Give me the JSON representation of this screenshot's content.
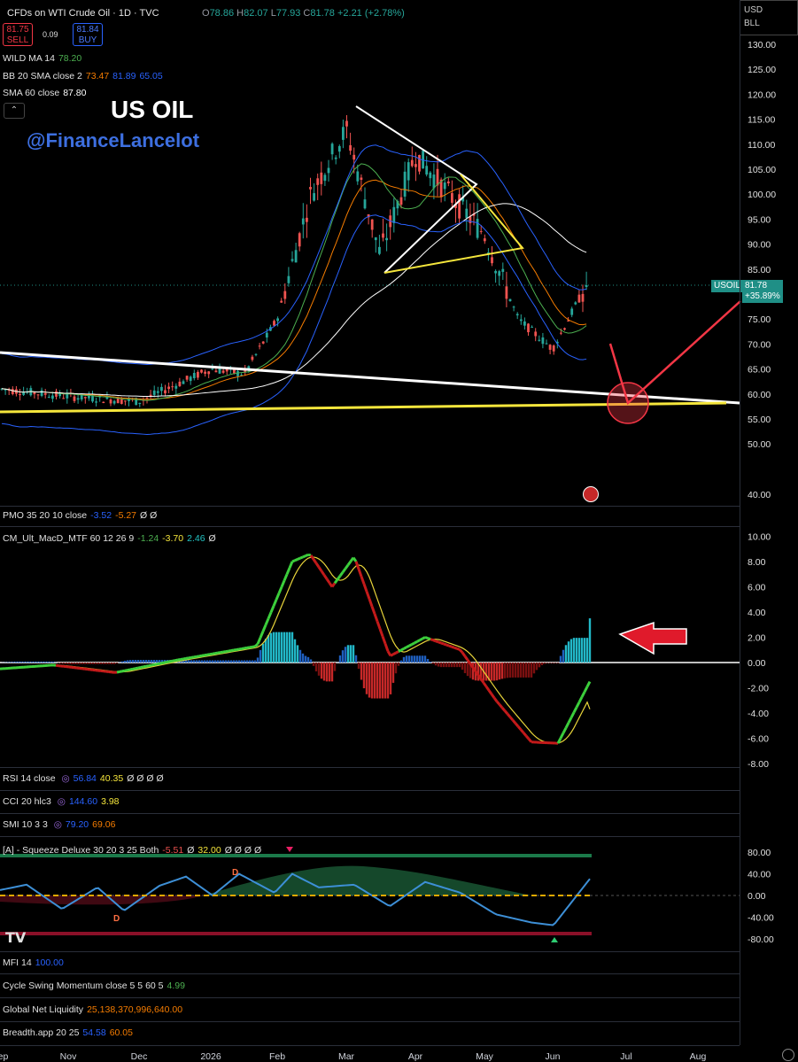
{
  "header": {
    "symbol": "CFDs on WTI Crude Oil · 1D · TVC",
    "o_label": "O",
    "o_value": "78.86",
    "h_label": "H",
    "h_value": "82.07",
    "l_label": "L",
    "l_value": "77.93",
    "c_label": "C",
    "c_value": "81.78",
    "change": "+2.21 (+2.78%)"
  },
  "trade": {
    "sell_price": "81.75",
    "sell_label": "SELL",
    "spread": "0.09",
    "buy_price": "81.84",
    "buy_label": "BUY"
  },
  "currency": {
    "line1": "USD",
    "line2": "BLL"
  },
  "overlay": {
    "title": "US OIL",
    "handle": "@FinanceLancelot"
  },
  "legends": {
    "wild": {
      "name": "WILD MA 14",
      "v1": "78.20"
    },
    "bb": {
      "name": "BB 20 SMA close 2",
      "v1": "73.47",
      "v2": "81.89",
      "v3": "65.05"
    },
    "sma": {
      "name": "SMA 60 close",
      "v1": "87.80"
    },
    "pmo": {
      "name": "PMO 35 20 10 close",
      "v1": "-3.52",
      "v2": "-5.27",
      "v3": "Ø Ø"
    },
    "macd": {
      "name": "CM_Ult_MacD_MTF 60 12 26 9",
      "v1": "-1.24",
      "v2": "-3.70",
      "v3": "2.46",
      "v4": "Ø"
    },
    "rsi": {
      "name": "RSI 14 close",
      "v1": "56.84",
      "v2": "40.35",
      "v3": "Ø Ø Ø Ø"
    },
    "cci": {
      "name": "CCI 20 hlc3",
      "v1": "144.60",
      "v2": "3.98"
    },
    "smi": {
      "name": "SMI 10 3 3",
      "v1": "79.20",
      "v2": "69.06"
    },
    "sqz": {
      "name": "[A] - Squeeze Deluxe 30 20 3 25 Both",
      "v1": "-5.51",
      "v2": "Ø",
      "v3": "32.00",
      "v4": "Ø Ø Ø Ø"
    },
    "mfi": {
      "name": "MFI 14",
      "v1": "100.00"
    },
    "csm": {
      "name": "Cycle Swing Momentum close 5 5 60 5",
      "v1": "4.99"
    },
    "gnl": {
      "name": "Global Net Liquidity",
      "v1": "25,138,370,996,640.00"
    },
    "breadth": {
      "name": "Breadth.app 20 25",
      "v1": "54.58",
      "v2": "60.05"
    }
  },
  "price_tag": {
    "symbol": "USOIL",
    "price": "81.78",
    "change": "+35.89%"
  },
  "colors": {
    "up": "#26a69a",
    "down": "#ef5350",
    "bb": "#2962ff",
    "wild": "#f57c00",
    "sma": "#ffffff",
    "annot_red": "#f23645",
    "annot_yellow": "#f5e63c"
  },
  "chart_data": [
    {
      "type": "candlestick",
      "title": "CFDs on WTI Crude Oil · 1D · TVC",
      "x_ticks": [
        "Nov",
        "Dec",
        "2026",
        "Feb",
        "Mar",
        "Apr",
        "May",
        "Jun",
        "Jul",
        "Aug",
        "Sep"
      ],
      "y_ticks": [
        130,
        125,
        120,
        115,
        110,
        105,
        100,
        95,
        90,
        85,
        80,
        75,
        70,
        65,
        60,
        55,
        50,
        40
      ],
      "close_path": [
        [
          "Nov",
          61
        ],
        [
          "Dec",
          59.5
        ],
        [
          "2026",
          58.5
        ],
        [
          "Feb",
          65
        ],
        [
          "Feb",
          64
        ],
        [
          "Mar",
          75
        ],
        [
          "Mar",
          100
        ],
        [
          "Apr",
          113
        ],
        [
          "Apr",
          88
        ],
        [
          "May",
          108
        ],
        [
          "May",
          100
        ],
        [
          "Jun",
          92
        ],
        [
          "Jun",
          75
        ],
        [
          "Jul",
          69
        ],
        [
          "Jul",
          81.78
        ]
      ],
      "last_close": 81.78
    },
    {
      "type": "line",
      "title": "CM_Ult_MacD_MTF 60 12 26 9",
      "y_ticks": [
        10,
        8,
        6,
        4,
        2,
        0,
        -2,
        -4,
        -6,
        -8
      ],
      "last": {
        "macd": -1.24,
        "signal": -3.7,
        "histogram": 2.46
      }
    },
    {
      "type": "area",
      "title": "[A] - Squeeze Deluxe 30 20 3 25 Both",
      "y_ticks": [
        80,
        40,
        0,
        -40,
        -80
      ]
    }
  ]
}
